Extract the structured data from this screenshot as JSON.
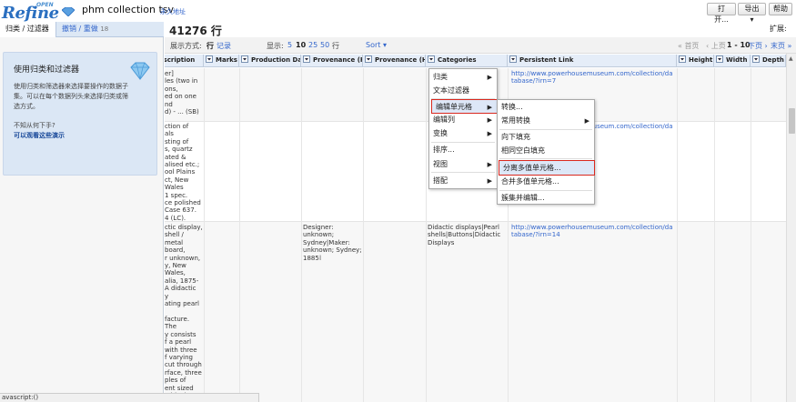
{
  "header": {
    "logo_small": "OPEN",
    "logo_big": "Refine",
    "project_title": "phm collection tsv",
    "permalink": "永久地址",
    "btn_open": "打开...",
    "btn_export": "导出",
    "btn_help": "帮助"
  },
  "left": {
    "tab_facets": "归类 / 过滤器",
    "tab_history": "撤销 / 重做",
    "tab_history_count": "18",
    "help_title": "使用归类和过滤器",
    "help_text": "使用归类和筛选器来选择要操作的数据子集。可以在每个数据列头来选择归类或筛选方式。",
    "help_question": "不知从何下手?",
    "help_link": "可以观看这些演示"
  },
  "toolbar": {
    "row_count": "41276 行",
    "extensions": "扩展:",
    "show_as_label": "展示方式:",
    "show_rows": "行",
    "show_records": "记录",
    "show_label": "显示:",
    "page_sizes": [
      "5",
      "10",
      "25",
      "50"
    ],
    "page_size_active": "10",
    "page_size_suffix": "行",
    "sort": "Sort",
    "first": "« 首页",
    "prev": "‹ 上页",
    "range": "1 - 10",
    "next": "下页 ›",
    "last": "末页 »"
  },
  "columns": [
    "Description",
    "Marks",
    "Production Date",
    "Provenance (Pro",
    "Provenance (His",
    "Categories",
    "Persistent Link",
    "Height",
    "Width",
    "Depth"
  ],
  "rows": [
    {
      "desc": "er]\nles (two in\nons,\ned on one\nnd\nd) - ... (SB)",
      "prov_pro": "",
      "categories": "",
      "link": "http://www.powerhousemuseum.com/collection/database/?irn=7"
    },
    {
      "desc": "ction of\nals\nsting of\ns, quartz\nated &\nalised etc.;\nool Plains\nct, New\nWales\n1 spec.\nce polished\nCase 637.\n4 (LC).",
      "prov_pro": "",
      "categories": "",
      "link": "http://www.powerhousemuseum.com/collection/database/?irn=9"
    },
    {
      "desc": "ctic display,\nshell / metal\nboard,\nr unknown,\ny, New\nWales,\nalia, 1875-\nA didactic\ny\nating pearl\n\nfacture. The\ny consists\nf a pearl\nwith three\nf varying\ncut through\nrface, three\nples of\nent sized\nn blanks',\nare the\nr pieces of\nremoved",
      "prov_pro": "Designer: unknown;\nSydney|Maker:\nunknown; Sydney;\n1885|",
      "categories": "Didactic displays|Pearl\nshells|Buttons|Didactic\nDisplays",
      "link": "http://www.powerhousemuseum.com/collection/database/?irn=14"
    }
  ],
  "status": "avascript:()",
  "menu_main": {
    "items": [
      "归类",
      "文本过滤器",
      "编辑单元格",
      "编辑列",
      "变换",
      "排序...",
      "视图",
      "搭配"
    ]
  },
  "menu_sub": {
    "items": [
      "转换...",
      "常用转换",
      "向下填充",
      "相同空白填充",
      "分离多值单元格...",
      "合并多值单元格...",
      "簇集并编辑..."
    ]
  },
  "colors": {
    "accent": "#3366cc",
    "header_bg": "#e5edf8",
    "highlight_box": "#d9281e",
    "left_panel": "#dbe7f5"
  }
}
